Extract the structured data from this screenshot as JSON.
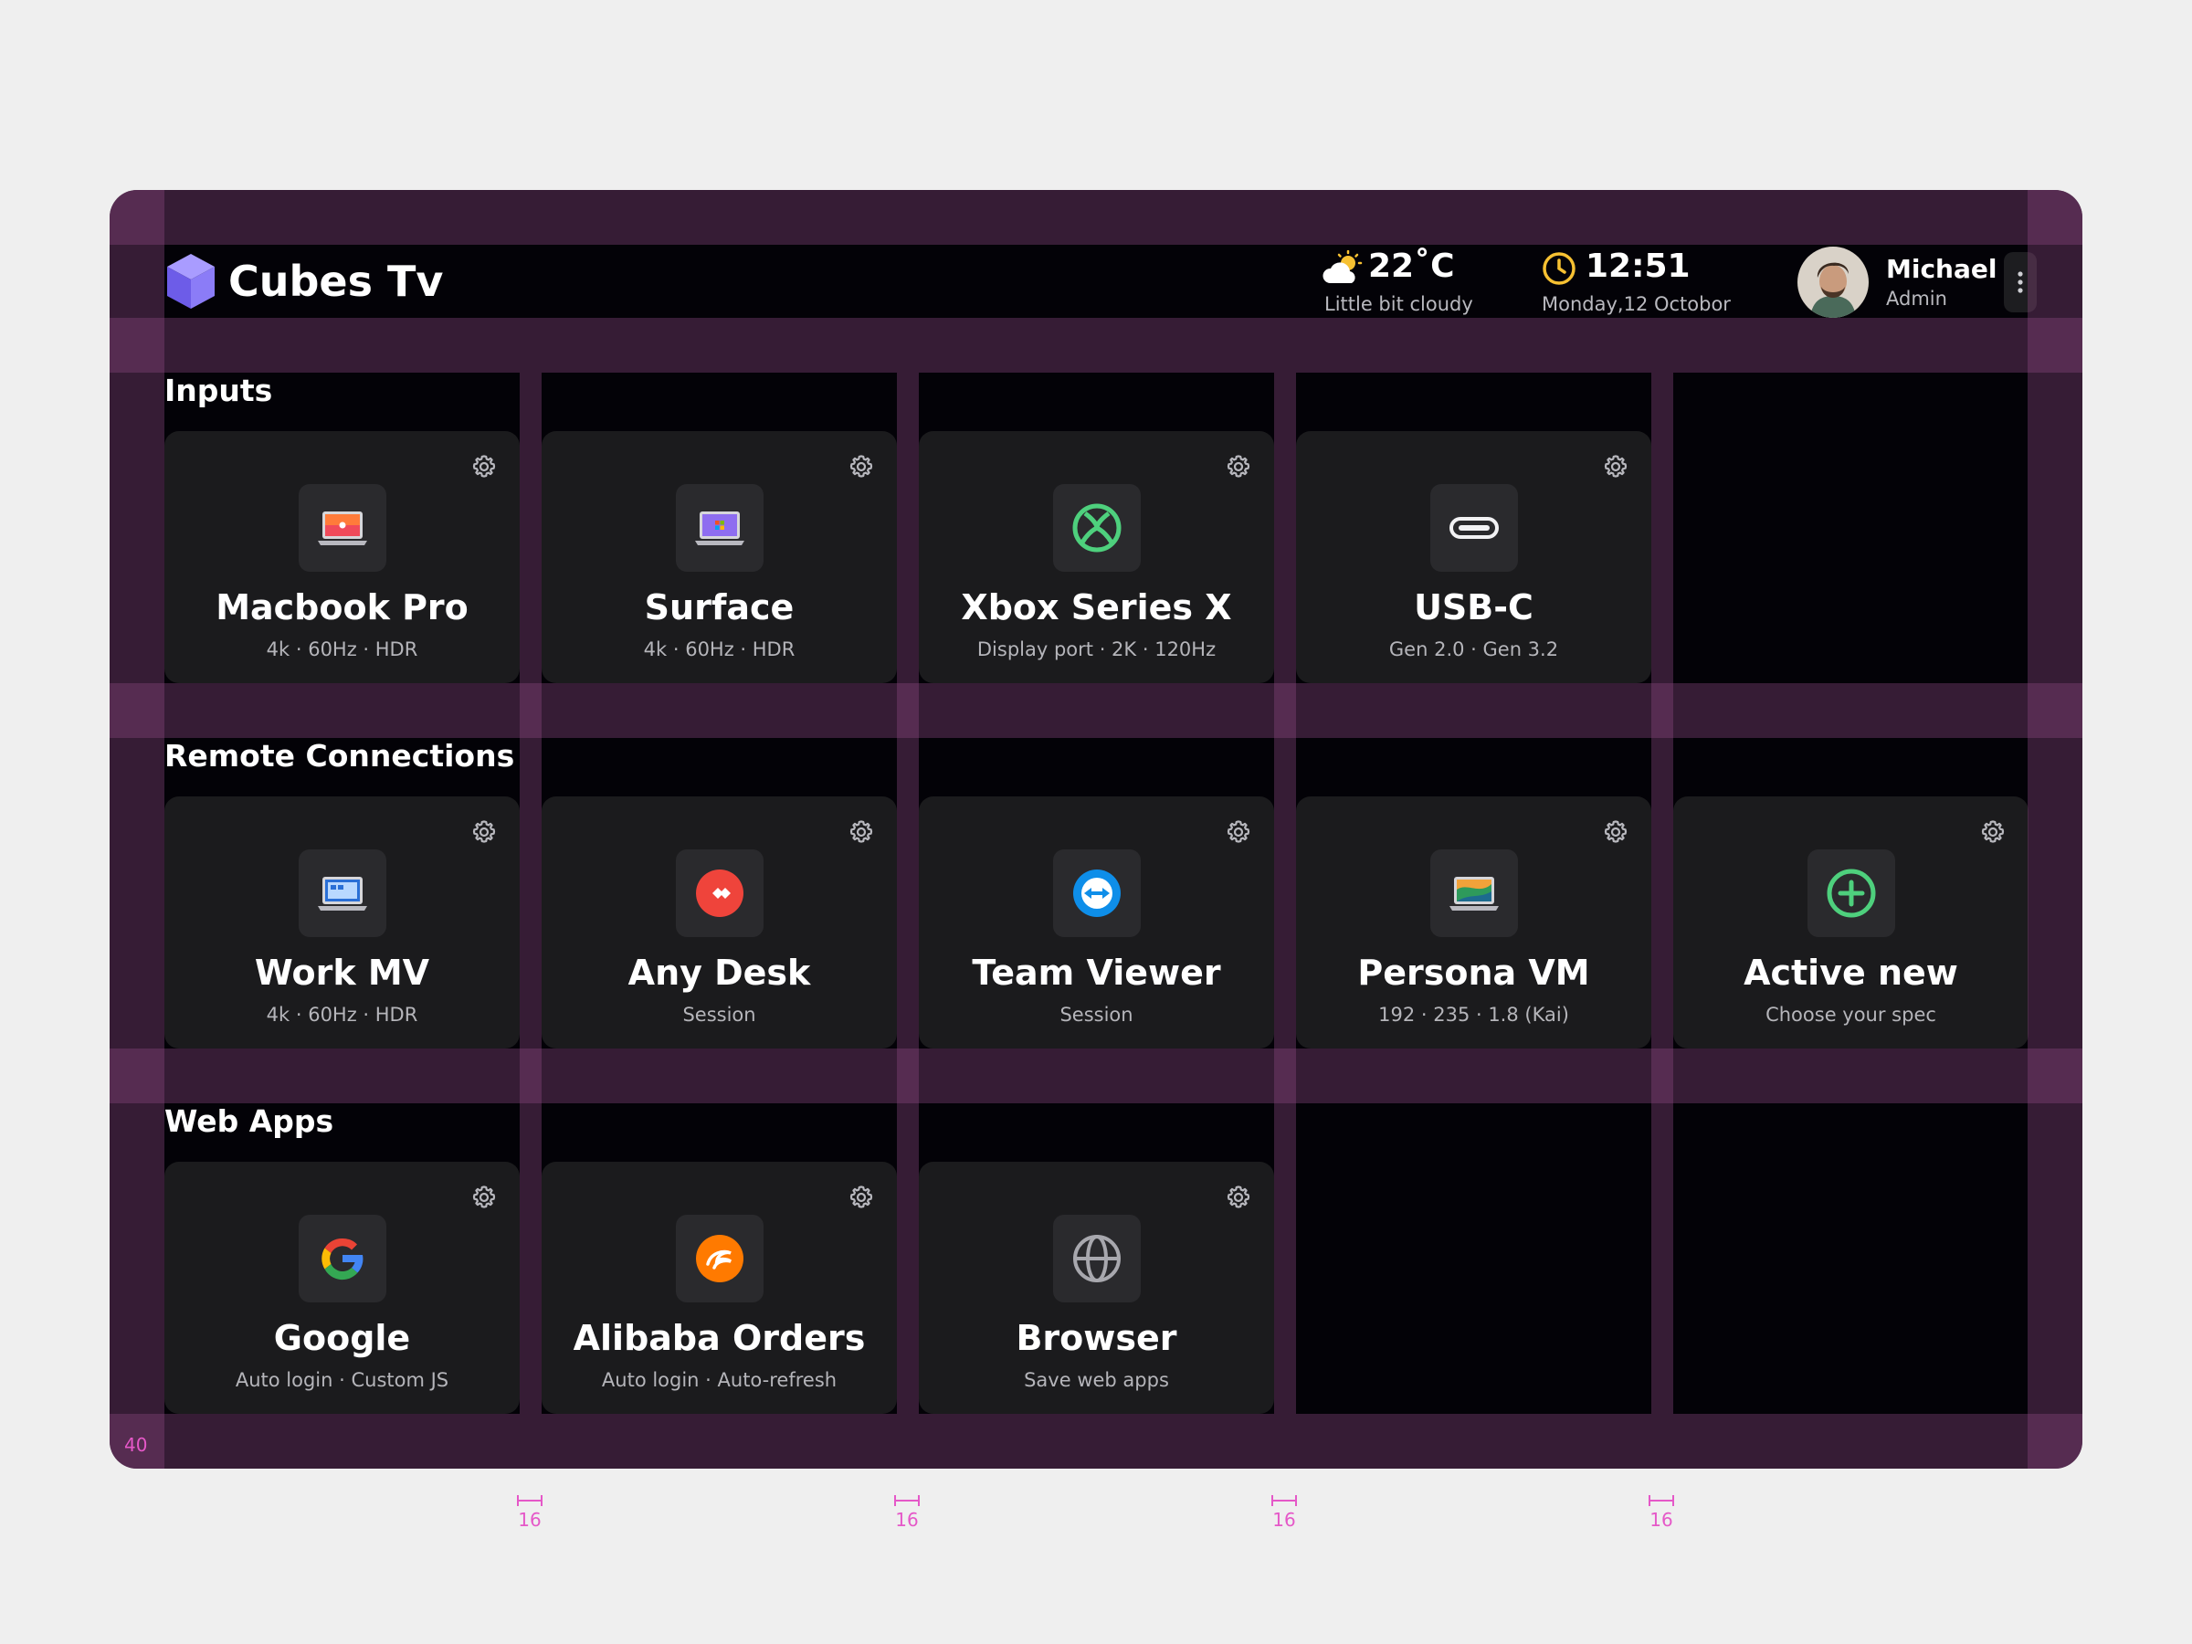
{
  "app": {
    "title": "Cubes Tv"
  },
  "header": {
    "weather": {
      "temp": "22˚C",
      "desc": "Little bit cloudy"
    },
    "clock": {
      "time": "12:51",
      "date": "Monday,12 Octobor"
    },
    "user": {
      "name": "Michael",
      "role": "Admin"
    }
  },
  "sections": [
    {
      "title": "Inputs",
      "cards": [
        {
          "title": "Macbook Pro",
          "sub": "4k · 60Hz · HDR",
          "icon": "macbook-icon"
        },
        {
          "title": "Surface",
          "sub": "4k · 60Hz · HDR",
          "icon": "surface-laptop-icon"
        },
        {
          "title": "Xbox Series X",
          "sub": "Display port · 2K · 120Hz",
          "icon": "xbox-icon"
        },
        {
          "title": "USB-C",
          "sub": "Gen 2.0 · Gen 3.2",
          "icon": "usb-c-icon"
        }
      ]
    },
    {
      "title": "Remote Connections",
      "cards": [
        {
          "title": "Work MV",
          "sub": "4k · 60Hz · HDR",
          "icon": "windows-laptop-icon"
        },
        {
          "title": "Any Desk",
          "sub": "Session",
          "icon": "anydesk-icon"
        },
        {
          "title": "Team Viewer",
          "sub": "Session",
          "icon": "teamviewer-icon"
        },
        {
          "title": "Persona VM",
          "sub": "192 · 235 · 1.8 (Kai)",
          "icon": "mac-laptop-icon"
        },
        {
          "title": "Active new",
          "sub": "Choose your spec",
          "icon": "add-circle-icon"
        }
      ]
    },
    {
      "title": "Web Apps",
      "cards": [
        {
          "title": "Google",
          "sub": "Auto login · Custom JS",
          "icon": "google-icon"
        },
        {
          "title": "Alibaba Orders",
          "sub": "Auto login · Auto-refresh",
          "icon": "alibaba-icon"
        },
        {
          "title": "Browser",
          "sub": "Save web apps",
          "icon": "globe-icon"
        }
      ]
    }
  ],
  "layout_guides": {
    "margin": "40",
    "gutters": [
      "16",
      "16",
      "16",
      "16"
    ]
  },
  "colors": {
    "background": "#030207",
    "card": "#1b1b1d",
    "accent": "#7b6cf6",
    "success": "#4ed07d",
    "guide": "#e558c8"
  }
}
